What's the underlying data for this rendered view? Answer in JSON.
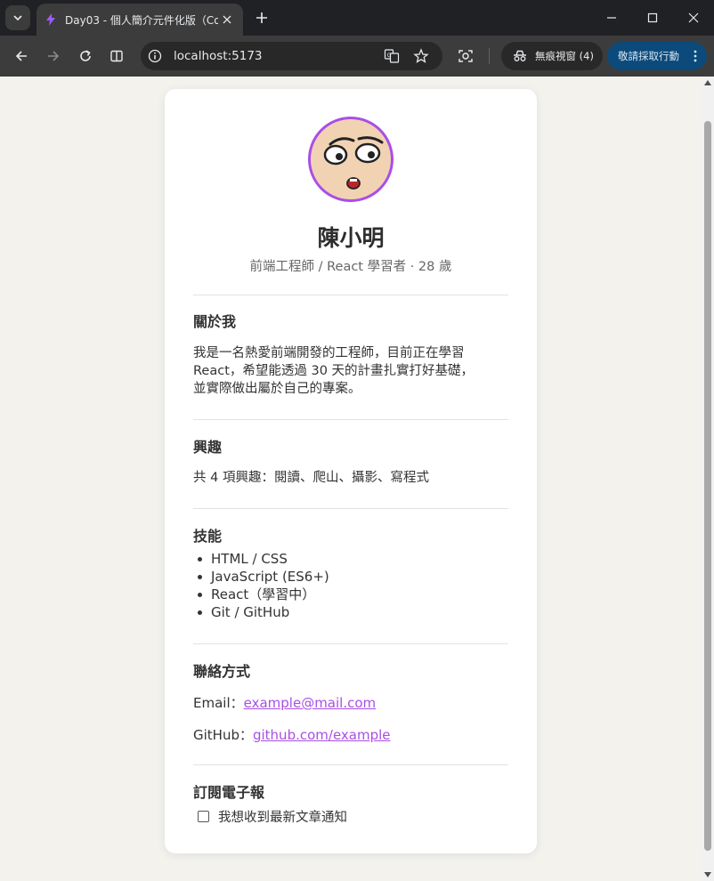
{
  "browser": {
    "tab_title": "Day03 - 個人簡介元件化版（Co",
    "url": "localhost:5173",
    "incognito_label": "無痕視窗 (4)",
    "action_label": "敬請採取行動"
  },
  "profile": {
    "name": "陳小明",
    "subtitle": "前端工程師 / React 學習者 · 28 歲"
  },
  "about": {
    "title": "關於我",
    "lines": [
      "我是一名熱愛前端開發的工程師，目前正在學習",
      "React，希望能透過 30 天的計畫扎實打好基礎，",
      "並實際做出屬於自己的專案。"
    ]
  },
  "interests": {
    "title": "興趣",
    "text": "共 4 項興趣：閱讀、爬山、攝影、寫程式"
  },
  "skills": {
    "title": "技能",
    "items": [
      "HTML / CSS",
      "JavaScript (ES6+)",
      "React（學習中）",
      "Git / GitHub"
    ]
  },
  "contact": {
    "title": "聯絡方式",
    "email_label": "Email：",
    "email": "example@mail.com",
    "github_label": "GitHub：",
    "github": "github.com/example"
  },
  "newsletter": {
    "title": "訂閱電子報",
    "checkbox_label": "我想收到最新文章通知",
    "checked": false
  },
  "colors": {
    "accent": "#a94ee6",
    "page_bg": "#f3f2ed",
    "card_bg": "#ffffff"
  }
}
